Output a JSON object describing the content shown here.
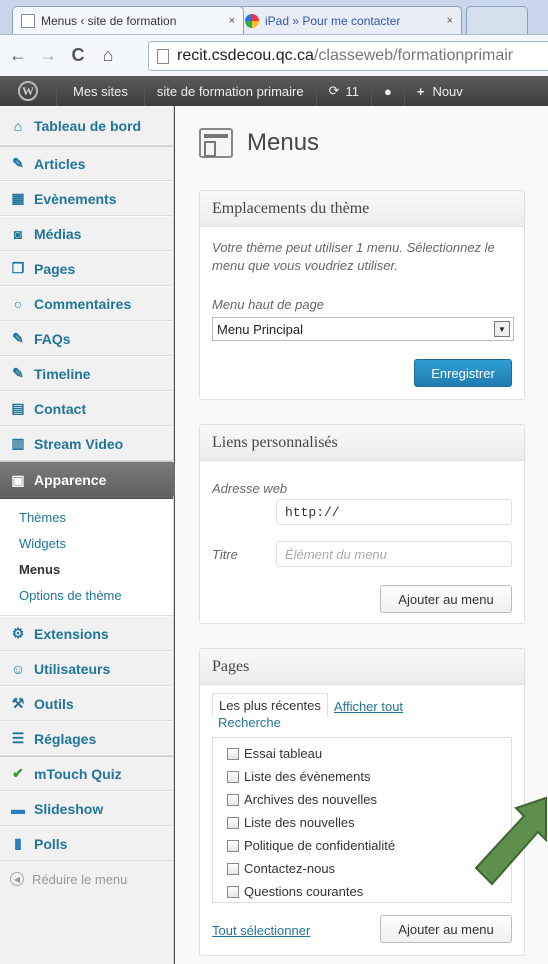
{
  "browser": {
    "tabs": [
      {
        "title": "Menus ‹ site de formation",
        "close": "×"
      },
      {
        "title": "iPad » Pour me contacter",
        "close": "×"
      }
    ],
    "url_host": "recit.csdecou.qc.ca",
    "url_path": "/classeweb/formationprimair"
  },
  "adminbar": {
    "my_sites": "Mes sites",
    "site": "site de formation primaire",
    "updates": "11",
    "new": "Nouv"
  },
  "sidebar": {
    "items": [
      {
        "label": "Tableau de bord"
      },
      {
        "label": "Articles"
      },
      {
        "label": "Evènements"
      },
      {
        "label": "Médias"
      },
      {
        "label": "Pages"
      },
      {
        "label": "Commentaires"
      },
      {
        "label": "FAQs"
      },
      {
        "label": "Timeline"
      },
      {
        "label": "Contact"
      },
      {
        "label": "Stream Video"
      },
      {
        "label": "Apparence"
      },
      {
        "label": "Extensions"
      },
      {
        "label": "Utilisateurs"
      },
      {
        "label": "Outils"
      },
      {
        "label": "Réglages"
      },
      {
        "label": "mTouch Quiz"
      },
      {
        "label": "Slideshow"
      },
      {
        "label": "Polls"
      }
    ],
    "submenu": [
      {
        "label": "Thèmes"
      },
      {
        "label": "Widgets"
      },
      {
        "label": "Menus"
      },
      {
        "label": "Options de thème"
      }
    ],
    "collapse": "Réduire le menu"
  },
  "main": {
    "title": "Menus",
    "locations": {
      "heading": "Emplacements du thème",
      "description": "Votre thème peut utiliser 1 menu. Sélectionnez le menu que vous voudriez utiliser.",
      "field_label": "Menu haut de page",
      "selected": "Menu Principal",
      "save": "Enregistrer"
    },
    "custom_links": {
      "heading": "Liens personnalisés",
      "url_label": "Adresse web",
      "url_value": "http://",
      "title_label": "Titre",
      "title_placeholder": "Élément du menu",
      "add": "Ajouter au menu"
    },
    "pages": {
      "heading": "Pages",
      "tab_recent": "Les plus récentes",
      "tab_all": "Afficher tout",
      "tab_search": "Recherche",
      "items": [
        "Essai tableau",
        "Liste des évènements",
        "Archives des nouvelles",
        "Liste des nouvelles",
        "Politique de confidentialité",
        "Contactez-nous",
        "Questions courantes"
      ],
      "select_all": "Tout sélectionner",
      "add": "Ajouter au menu"
    }
  },
  "colors": {
    "link": "#21759b",
    "primary_button": "#2a8fc4",
    "annotation_arrow": "#5e8f4d"
  }
}
